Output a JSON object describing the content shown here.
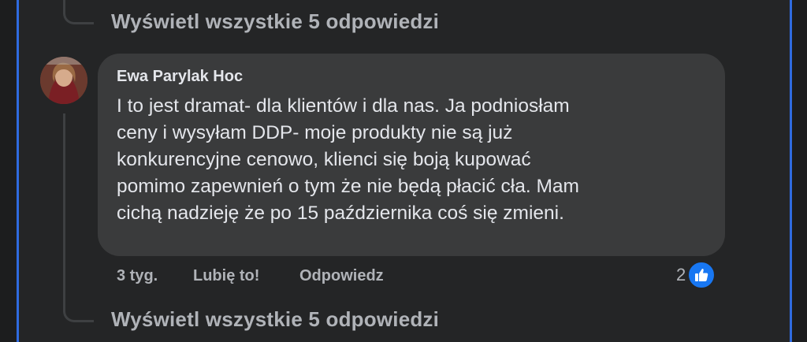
{
  "thread": {
    "view_replies_top": "Wyświetl wszystkie 5 odpowiedzi",
    "view_replies_bottom": "Wyświetl wszystkie 5 odpowiedzi"
  },
  "comment": {
    "author": "Ewa Parylak Hoc",
    "lines": [
      "I to jest dramat- dla klientów i dla nas. Ja podniosłam",
      "ceny i wysyłam DDP- moje produkty nie są już",
      "konkurencyjne cenowo, klienci się boją kupować",
      "pomimo zapewnień o tym że nie będą płacić cła. Mam",
      "cichą nadzieję że po 15 października coś się zmieni."
    ],
    "time": "3 tyg.",
    "like_label": "Lubię to!",
    "reply_label": "Odpowiedz",
    "reaction_count": "2",
    "reaction_icon": "thumbs-up-icon"
  },
  "colors": {
    "background": "#242526",
    "bubble": "#3a3b3c",
    "primary_text": "#e4e6eb",
    "secondary_text": "#b0b3b8",
    "accent": "#1877f2",
    "edge_blue": "#2f6be0"
  }
}
